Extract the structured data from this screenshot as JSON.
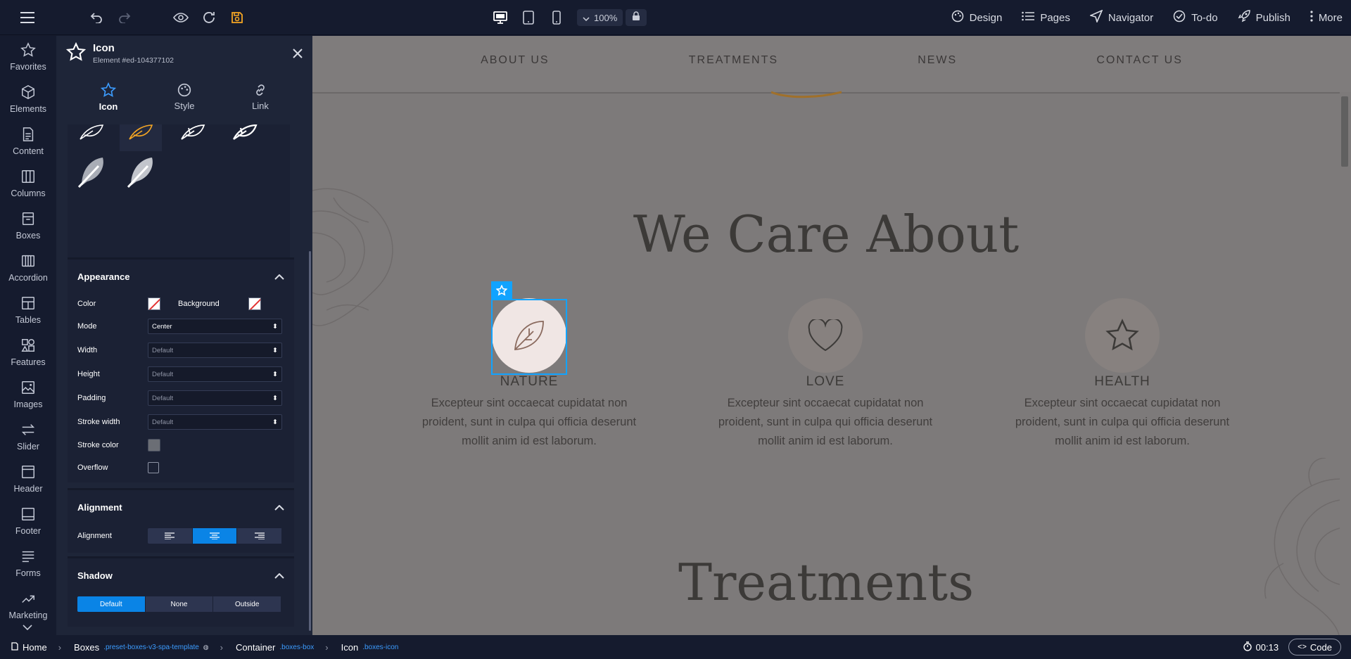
{
  "topbar": {
    "zoom": "100%",
    "menu": [
      "Design",
      "Pages",
      "Navigator",
      "To-do",
      "Publish",
      "More"
    ],
    "colors": {
      "save_icon": "#f5a623"
    }
  },
  "sidebar": {
    "items": [
      "Favorites",
      "Elements",
      "Content",
      "Columns",
      "Boxes",
      "Accordion",
      "Tables",
      "Features",
      "Images",
      "Slider",
      "Header",
      "Footer",
      "Forms",
      "Marketing"
    ]
  },
  "panel": {
    "title": "Icon",
    "subtitle": "Element #ed-104377102",
    "tabs": [
      "Icon",
      "Style",
      "Link"
    ],
    "appearance": {
      "title": "Appearance",
      "color_label": "Color",
      "background_label": "Background",
      "mode_label": "Mode",
      "mode_value": "Center",
      "width_label": "Width",
      "width_value": "Default",
      "height_label": "Height",
      "height_value": "Default",
      "padding_label": "Padding",
      "padding_value": "Default",
      "stroke_width_label": "Stroke width",
      "stroke_width_value": "Default",
      "stroke_color_label": "Stroke color",
      "overflow_label": "Overflow"
    },
    "alignment": {
      "title": "Alignment",
      "label": "Alignment"
    },
    "shadow": {
      "title": "Shadow",
      "options": [
        "Default",
        "None",
        "Outside"
      ]
    }
  },
  "canvas": {
    "nav": [
      "ABOUT US",
      "TREATMENTS",
      "NEWS",
      "CONTACT US"
    ],
    "heading1": "We Care About",
    "features": [
      {
        "title": "NATURE",
        "text": "Excepteur sint occaecat cupidatat non proident, sunt in culpa qui officia deserunt mollit anim id est laborum."
      },
      {
        "title": "LOVE",
        "text": "Excepteur sint occaecat cupidatat non proident, sunt in culpa qui officia deserunt mollit anim id est laborum."
      },
      {
        "title": "HEALTH",
        "text": "Excepteur sint occaecat cupidatat non proident, sunt in culpa qui officia deserunt mollit anim id est laborum."
      }
    ],
    "heading2": "Treatments"
  },
  "bottombar": {
    "crumbs": [
      {
        "label": "Home",
        "cls": ""
      },
      {
        "label": "Boxes",
        "cls": ".preset-boxes-v3-spa-template"
      },
      {
        "label": "Container",
        "cls": ".boxes-box"
      },
      {
        "label": "Icon",
        "cls": ".boxes-icon"
      }
    ],
    "timer": "00:13",
    "code_label": "Code"
  }
}
